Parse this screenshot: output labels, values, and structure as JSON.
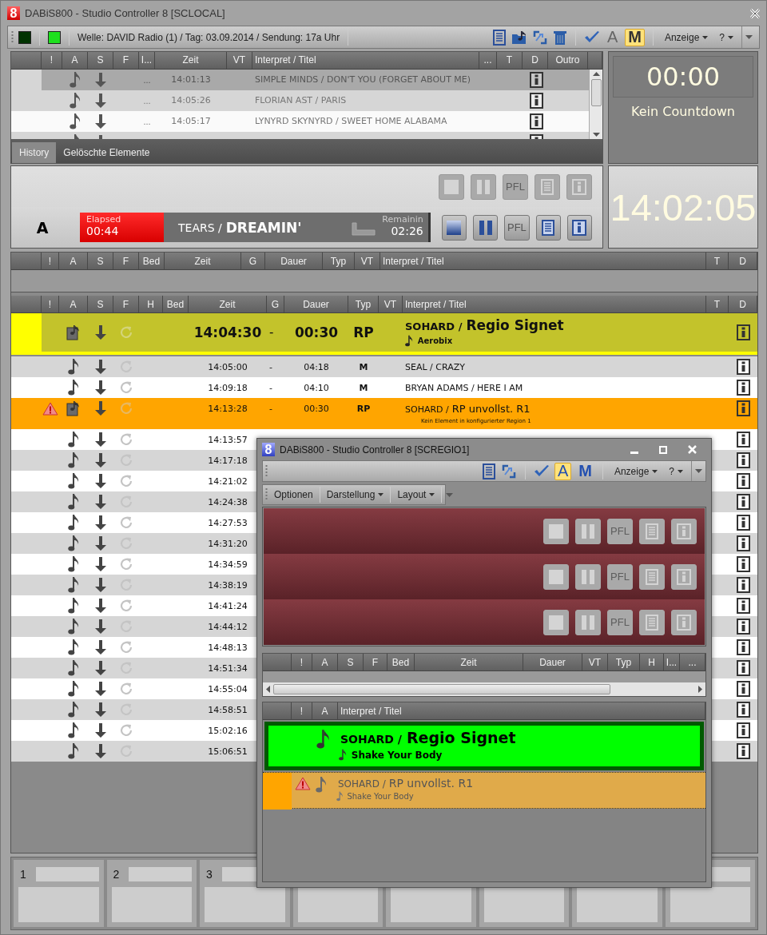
{
  "window": {
    "logo": "8",
    "title": "DABiS800 - Studio Controller 8 [SCLOCAL]"
  },
  "toolbar": {
    "status_lights": [
      {
        "color": "#003300"
      },
      {
        "color": "#1ee01e"
      }
    ],
    "info": "Welle: DAVID Radio (1) / Tag: 03.09.2014 / Sendung: 17a Uhr",
    "toggles": [
      {
        "label": "A",
        "selected": false
      },
      {
        "label": "M",
        "selected": true
      }
    ],
    "menus": [
      "Anzeige",
      "?"
    ]
  },
  "history": {
    "columns": [
      "!",
      "A",
      "S",
      "F",
      "I...",
      "Zeit",
      "VT",
      "Interpret / Titel",
      "...",
      "T",
      "D",
      "Outro"
    ],
    "rows": [
      {
        "selected": true,
        "marker": "...",
        "zeit": "14:01:13",
        "title": "SIMPLE MINDS / DON'T YOU (FORGET ABOUT ME)"
      },
      {
        "selected": false,
        "marker": "...",
        "zeit": "14:05:26",
        "title": "FLORIAN AST / PARIS"
      },
      {
        "selected": false,
        "marker": "...",
        "zeit": "14:05:17",
        "title": "LYNYRD SKYNYRD / SWEET HOME ALABAMA"
      },
      {
        "selected": false
      }
    ],
    "tabs": [
      {
        "label": "History",
        "selected": true
      },
      {
        "label": "Gelöschte Elemente",
        "selected": false
      }
    ]
  },
  "countdown": {
    "time": "00:00",
    "label": "Kein Countdown"
  },
  "player": {
    "decks": [
      {
        "active": false,
        "pfl_label": "PFL"
      },
      {
        "active": true,
        "pfl_label": "PFL",
        "channel": "A",
        "elapsed_label": "Elapsed",
        "elapsed": "00:44",
        "artist": "TEARS /",
        "title": "DREAMIN'",
        "remaining_label": "Remainin",
        "remaining": "02:26"
      }
    ]
  },
  "clock": {
    "time": "14:02:05"
  },
  "queue": {
    "columns": [
      "!",
      "A",
      "S",
      "F",
      "Bed",
      "Zeit",
      "G",
      "Dauer",
      "Typ",
      "VT",
      "Interpret / Titel",
      "T",
      "D"
    ]
  },
  "playlist": {
    "columns": [
      "!",
      "A",
      "S",
      "F",
      "H",
      "Bed",
      "Zeit",
      "G",
      "Dauer",
      "Typ",
      "VT",
      "Interpret / Titel",
      "T",
      "D"
    ],
    "rows": [
      {
        "kind": "current",
        "zeit": "14:04:30",
        "g": "-",
        "dauer": "00:30",
        "typ": "RP",
        "artist": "SOHARD /",
        "title": "Regio Signet",
        "subtitle": "Aerobix"
      },
      {
        "kind": "track",
        "zeit": "14:05:00",
        "g": "-",
        "dauer": "04:18",
        "typ": "M",
        "title": "SEAL / CRAZY"
      },
      {
        "kind": "track",
        "zeit": "14:09:18",
        "g": "-",
        "dauer": "04:10",
        "typ": "M",
        "title": "BRYAN ADAMS / HERE I AM"
      },
      {
        "kind": "warning",
        "zeit": "14:13:28",
        "g": "-",
        "dauer": "00:30",
        "typ": "RP",
        "artist": "SOHARD /",
        "title": "RP unvollst. R1",
        "subtitle": "Kein Element in konfigurierter Region 1"
      },
      {
        "kind": "track",
        "zeit": "14:13:57"
      },
      {
        "kind": "track",
        "zeit": "14:17:18"
      },
      {
        "kind": "track",
        "zeit": "14:21:02"
      },
      {
        "kind": "track",
        "zeit": "14:24:38"
      },
      {
        "kind": "track",
        "zeit": "14:27:53"
      },
      {
        "kind": "track",
        "zeit": "14:31:20"
      },
      {
        "kind": "track",
        "zeit": "14:34:59"
      },
      {
        "kind": "track",
        "zeit": "14:38:19"
      },
      {
        "kind": "track",
        "zeit": "14:41:24"
      },
      {
        "kind": "track",
        "zeit": "14:44:12"
      },
      {
        "kind": "track",
        "zeit": "14:48:13"
      },
      {
        "kind": "track",
        "zeit": "14:51:34"
      },
      {
        "kind": "track",
        "zeit": "14:55:04"
      },
      {
        "kind": "track",
        "zeit": "14:58:51"
      },
      {
        "kind": "track",
        "zeit": "15:02:16"
      },
      {
        "kind": "track",
        "zeit": "15:06:51"
      }
    ]
  },
  "slots": [
    {
      "kind": "numbered",
      "label": "1"
    },
    {
      "kind": "numbered",
      "label": "2"
    },
    {
      "kind": "numbered",
      "label": "3"
    },
    {
      "kind": "covered"
    },
    {
      "kind": "covered"
    },
    {
      "kind": "covered"
    },
    {
      "kind": "covered"
    },
    {
      "kind": "blank"
    }
  ],
  "child_window": {
    "logo": "8",
    "title": "DABiS800 - Studio Controller 8 [SCREGIO1]",
    "toggles": [
      {
        "label": "A",
        "selected": true
      },
      {
        "label": "M",
        "selected": false
      }
    ],
    "menus": [
      "Anzeige",
      "?"
    ],
    "menubar": [
      {
        "label": "Optionen",
        "dropdown": false
      },
      {
        "label": "Darstellung",
        "dropdown": true
      },
      {
        "label": "Layout",
        "dropdown": true
      }
    ],
    "decks": [
      {
        "pfl_label": "PFL"
      },
      {
        "pfl_label": "PFL"
      },
      {
        "pfl_label": "PFL"
      }
    ],
    "grid_columns": [
      "!",
      "A",
      "S",
      "F",
      "Bed",
      "Zeit",
      "Dauer",
      "VT",
      "Typ",
      "H",
      "I...",
      "..."
    ],
    "list_columns": [
      "!",
      "A",
      "Interpret / Titel"
    ],
    "items": [
      {
        "kind": "on_air",
        "artist": "SOHARD /",
        "title": "Regio Signet",
        "subtitle": "Shake Your Body"
      },
      {
        "kind": "warning",
        "artist": "SOHARD /",
        "title": "RP unvollst. R1",
        "subtitle": "Shake Your Body"
      }
    ]
  }
}
